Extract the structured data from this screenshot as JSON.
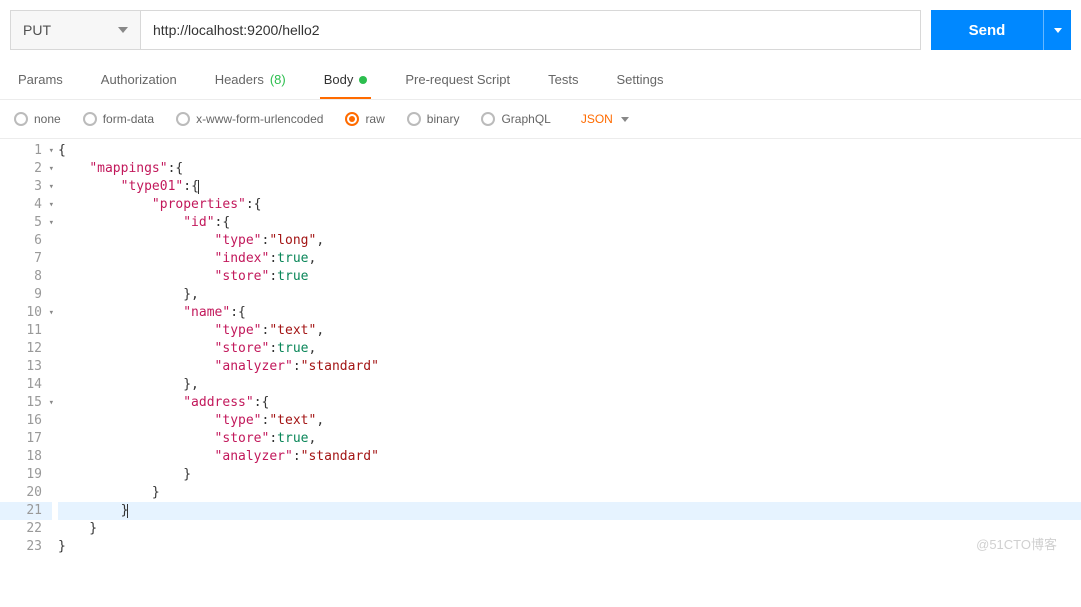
{
  "request": {
    "method": "PUT",
    "url": "http://localhost:9200/hello2",
    "send_label": "Send"
  },
  "tabs": [
    {
      "label": "Params"
    },
    {
      "label": "Authorization"
    },
    {
      "label": "Headers",
      "count": "(8)"
    },
    {
      "label": "Body",
      "active": true,
      "modified": true
    },
    {
      "label": "Pre-request Script"
    },
    {
      "label": "Tests"
    },
    {
      "label": "Settings"
    }
  ],
  "body_options": {
    "radios": [
      "none",
      "form-data",
      "x-www-form-urlencoded",
      "raw",
      "binary",
      "GraphQL"
    ],
    "selected": "raw",
    "type_label": "JSON"
  },
  "editor": {
    "cursor_line": 21,
    "lines": [
      {
        "n": 1,
        "fold": true,
        "t": [
          {
            "c": "p",
            "x": "{"
          }
        ]
      },
      {
        "n": 2,
        "fold": true,
        "t": [
          {
            "c": "p",
            "x": "    "
          },
          {
            "c": "k",
            "x": "\"mappings\""
          },
          {
            "c": "p",
            "x": ":{"
          }
        ]
      },
      {
        "n": 3,
        "fold": true,
        "t": [
          {
            "c": "p",
            "x": "        "
          },
          {
            "c": "k",
            "x": "\"type01\""
          },
          {
            "c": "p",
            "x": ":{"
          },
          {
            "cursor": true
          }
        ]
      },
      {
        "n": 4,
        "fold": true,
        "t": [
          {
            "c": "p",
            "x": "            "
          },
          {
            "c": "k",
            "x": "\"properties\""
          },
          {
            "c": "p",
            "x": ":{"
          }
        ]
      },
      {
        "n": 5,
        "fold": true,
        "t": [
          {
            "c": "p",
            "x": "                "
          },
          {
            "c": "k",
            "x": "\"id\""
          },
          {
            "c": "p",
            "x": ":{"
          }
        ]
      },
      {
        "n": 6,
        "t": [
          {
            "c": "p",
            "x": "                    "
          },
          {
            "c": "k",
            "x": "\"type\""
          },
          {
            "c": "p",
            "x": ":"
          },
          {
            "c": "s",
            "x": "\"long\""
          },
          {
            "c": "p",
            "x": ","
          }
        ]
      },
      {
        "n": 7,
        "t": [
          {
            "c": "p",
            "x": "                    "
          },
          {
            "c": "k",
            "x": "\"index\""
          },
          {
            "c": "p",
            "x": ":"
          },
          {
            "c": "v",
            "x": "true"
          },
          {
            "c": "p",
            "x": ","
          }
        ]
      },
      {
        "n": 8,
        "t": [
          {
            "c": "p",
            "x": "                    "
          },
          {
            "c": "k",
            "x": "\"store\""
          },
          {
            "c": "p",
            "x": ":"
          },
          {
            "c": "v",
            "x": "true"
          }
        ]
      },
      {
        "n": 9,
        "t": [
          {
            "c": "p",
            "x": "                },"
          }
        ]
      },
      {
        "n": 10,
        "fold": true,
        "t": [
          {
            "c": "p",
            "x": "                "
          },
          {
            "c": "k",
            "x": "\"name\""
          },
          {
            "c": "p",
            "x": ":{"
          }
        ]
      },
      {
        "n": 11,
        "t": [
          {
            "c": "p",
            "x": "                    "
          },
          {
            "c": "k",
            "x": "\"type\""
          },
          {
            "c": "p",
            "x": ":"
          },
          {
            "c": "s",
            "x": "\"text\""
          },
          {
            "c": "p",
            "x": ","
          }
        ]
      },
      {
        "n": 12,
        "t": [
          {
            "c": "p",
            "x": "                    "
          },
          {
            "c": "k",
            "x": "\"store\""
          },
          {
            "c": "p",
            "x": ":"
          },
          {
            "c": "v",
            "x": "true"
          },
          {
            "c": "p",
            "x": ","
          }
        ]
      },
      {
        "n": 13,
        "t": [
          {
            "c": "p",
            "x": "                    "
          },
          {
            "c": "k",
            "x": "\"analyzer\""
          },
          {
            "c": "p",
            "x": ":"
          },
          {
            "c": "s",
            "x": "\"standard\""
          }
        ]
      },
      {
        "n": 14,
        "t": [
          {
            "c": "p",
            "x": "                },"
          }
        ]
      },
      {
        "n": 15,
        "fold": true,
        "t": [
          {
            "c": "p",
            "x": "                "
          },
          {
            "c": "k",
            "x": "\"address\""
          },
          {
            "c": "p",
            "x": ":{"
          }
        ]
      },
      {
        "n": 16,
        "t": [
          {
            "c": "p",
            "x": "                    "
          },
          {
            "c": "k",
            "x": "\"type\""
          },
          {
            "c": "p",
            "x": ":"
          },
          {
            "c": "s",
            "x": "\"text\""
          },
          {
            "c": "p",
            "x": ","
          }
        ]
      },
      {
        "n": 17,
        "t": [
          {
            "c": "p",
            "x": "                    "
          },
          {
            "c": "k",
            "x": "\"store\""
          },
          {
            "c": "p",
            "x": ":"
          },
          {
            "c": "v",
            "x": "true"
          },
          {
            "c": "p",
            "x": ","
          }
        ]
      },
      {
        "n": 18,
        "t": [
          {
            "c": "p",
            "x": "                    "
          },
          {
            "c": "k",
            "x": "\"analyzer\""
          },
          {
            "c": "p",
            "x": ":"
          },
          {
            "c": "s",
            "x": "\"standard\""
          }
        ]
      },
      {
        "n": 19,
        "t": [
          {
            "c": "p",
            "x": "                }"
          }
        ]
      },
      {
        "n": 20,
        "t": [
          {
            "c": "p",
            "x": "            }"
          }
        ]
      },
      {
        "n": 21,
        "hl": true,
        "t": [
          {
            "c": "p",
            "x": "        }"
          },
          {
            "cursor": true
          }
        ]
      },
      {
        "n": 22,
        "t": [
          {
            "c": "p",
            "x": "    }"
          }
        ]
      },
      {
        "n": 23,
        "t": [
          {
            "c": "p",
            "x": "}"
          }
        ]
      }
    ]
  },
  "watermark": "@51CTO博客"
}
